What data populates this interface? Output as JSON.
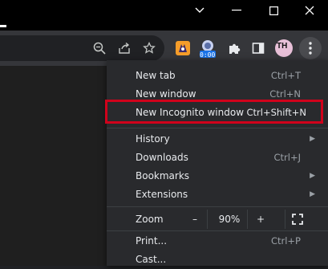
{
  "window_controls": {
    "dropdown_icon": "chevron-down-icon",
    "minimize_icon": "minimize-icon",
    "maximize_icon": "maximize-icon",
    "close_icon": "close-icon"
  },
  "toolbar": {
    "icons": [
      "zoom-icon",
      "share-icon",
      "bookmark-star-icon",
      "extension-fox-icon",
      "extension-timer-icon",
      "puzzle-icon",
      "sidepanel-icon",
      "avatar",
      "kebab-menu-icon"
    ],
    "timer_badge": "0:00",
    "avatar_initials": "TH"
  },
  "menu": {
    "new_tab": {
      "label": "New tab",
      "shortcut": "Ctrl+T"
    },
    "new_window": {
      "label": "New window",
      "shortcut": "Ctrl+N"
    },
    "new_incognito": {
      "label": "New Incognito window",
      "shortcut": "Ctrl+Shift+N"
    },
    "history": {
      "label": "History"
    },
    "downloads": {
      "label": "Downloads",
      "shortcut": "Ctrl+J"
    },
    "bookmarks": {
      "label": "Bookmarks"
    },
    "extensions": {
      "label": "Extensions"
    },
    "zoom": {
      "label": "Zoom",
      "minus": "–",
      "value": "90%",
      "plus": "+"
    },
    "print": {
      "label": "Print...",
      "shortcut": "Ctrl+P"
    },
    "cast": {
      "label": "Cast..."
    }
  },
  "colors": {
    "highlight": "#d0021b",
    "accent": "#8ab4f8"
  }
}
